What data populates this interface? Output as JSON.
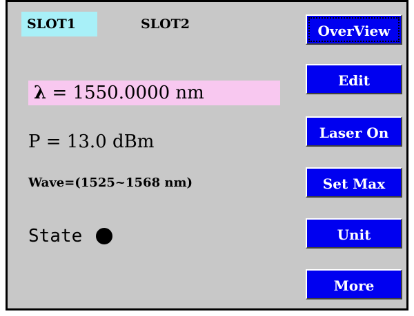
{
  "slots": {
    "slot1": "SLOT1",
    "slot2": "SLOT2"
  },
  "readout": {
    "wavelength_symbol": "λ",
    "wavelength_text": " = 1550.0000 nm",
    "power_text": "P = 13.0 dBm",
    "range_text": "Wave=(1525~1568 nm)",
    "state_label": "State"
  },
  "buttons": {
    "overview": "OverView",
    "edit": "Edit",
    "laser_on": "Laser On",
    "set_max": "Set Max",
    "unit": "Unit",
    "more": "More"
  },
  "colors": {
    "background": "#c8c8c8",
    "slot_active": "#a8f0f8",
    "wavelength_highlight": "#f8c8f0",
    "button": "#0000f0",
    "button_text": "#ffffff"
  },
  "icons": {
    "state_indicator": "filled-circle"
  }
}
